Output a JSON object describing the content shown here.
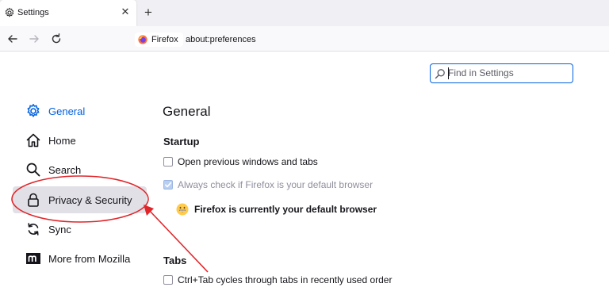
{
  "tab": {
    "title": "Settings",
    "close_glyph": "✕",
    "icon": "gear-icon"
  },
  "newtab_glyph": "+",
  "navbar": {
    "back_icon": "back-arrow-icon",
    "forward_icon": "forward-arrow-icon",
    "reload_icon": "reload-icon",
    "identity_label": "Firefox",
    "url": "about:preferences"
  },
  "search": {
    "placeholder": "Find in Settings"
  },
  "sidebar": {
    "items": [
      {
        "label": "General",
        "icon": "gear-icon",
        "selected": true
      },
      {
        "label": "Home",
        "icon": "home-icon"
      },
      {
        "label": "Search",
        "icon": "search-icon"
      },
      {
        "label": "Privacy & Security",
        "icon": "lock-icon",
        "hovered": true
      },
      {
        "label": "Sync",
        "icon": "sync-icon"
      },
      {
        "label": "More from Mozilla",
        "icon": "mozilla-icon"
      }
    ]
  },
  "main": {
    "title": "General",
    "startup": {
      "heading": "Startup",
      "restore_label": "Open previous windows and tabs",
      "restore_checked": false,
      "default_check_label": "Always check if Firefox is your default browser",
      "default_check_checked": true,
      "default_message": "Firefox is currently your default browser"
    },
    "tabs": {
      "heading": "Tabs",
      "ctrl_tab_label": "Ctrl+Tab cycles through tabs in recently used order",
      "ctrl_tab_checked": false
    }
  },
  "colors": {
    "accent": "#0061e0",
    "annotation": "#e0262b",
    "hover_bg": "#e0e0e6"
  }
}
